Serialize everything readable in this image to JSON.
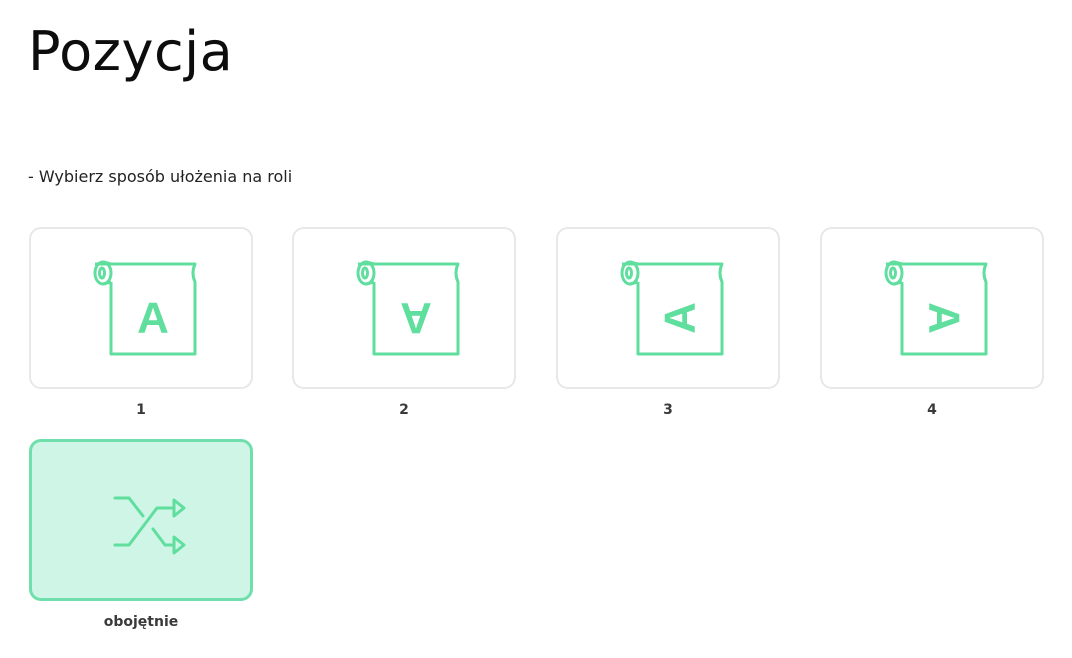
{
  "title": "Pozycja",
  "instruction": "- Wybierz sposób ułożenia na roli",
  "accent_color": "#5fde9e",
  "selected_fill": "#cff5e6",
  "tile_border": "#e8e8e8",
  "options": [
    {
      "label": "1",
      "icon": "roll-icon",
      "selected": false
    },
    {
      "label": "2",
      "icon": "roll-icon",
      "selected": false
    },
    {
      "label": "3",
      "icon": "roll-icon",
      "selected": false
    },
    {
      "label": "4",
      "icon": "roll-icon",
      "selected": false
    },
    {
      "label": "obojętnie",
      "icon": "shuffle-icon",
      "selected": true
    }
  ]
}
